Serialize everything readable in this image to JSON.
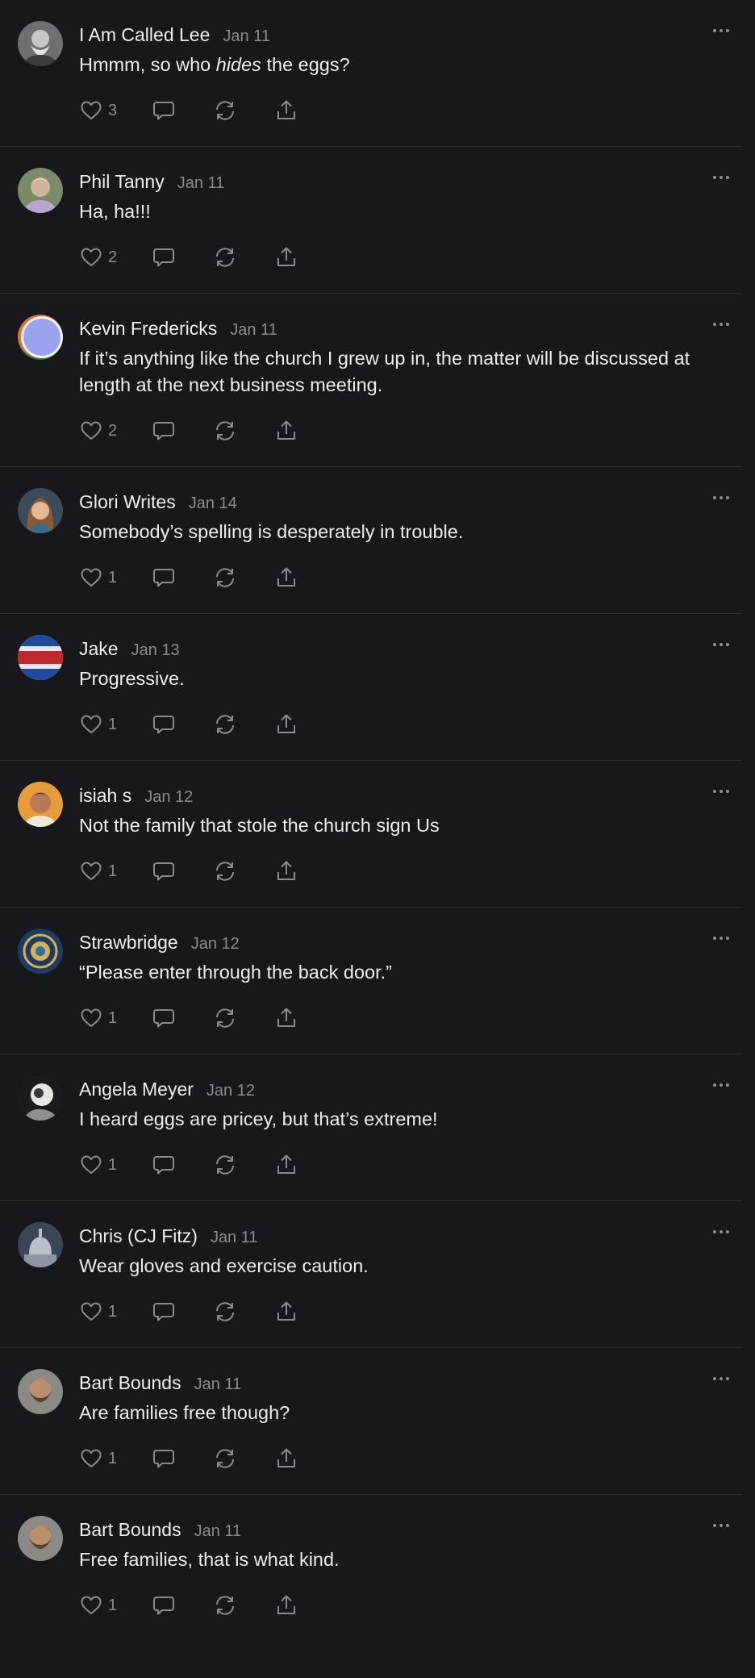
{
  "comments": [
    {
      "author": "I Am Called Lee",
      "date": "Jan 11",
      "text_before": "Hmmm, so who ",
      "text_em": "hides",
      "text_after": " the eggs?",
      "likes": "3",
      "avatar": {
        "icon": "avatar-bearded-man",
        "bg": "#6e6f72",
        "fg": "#d8d8d8"
      }
    },
    {
      "author": "Phil Tanny",
      "date": "Jan 11",
      "text": "Ha, ha!!!",
      "likes": "2",
      "avatar": {
        "icon": "avatar-man-outdoors",
        "bg": "#7d8a6a",
        "fg": "#c9b7d6"
      }
    },
    {
      "author": "Kevin Fredericks",
      "date": "Jan 11",
      "text": "If it’s anything like the church I grew up in, the matter will be discussed at length at the next business meeting.",
      "likes": "2",
      "avatar": {
        "icon": "avatar-color-rings",
        "bg": "#e3722f",
        "fg": "#9aa3ec"
      }
    },
    {
      "author": "Glori Writes",
      "date": "Jan 14",
      "text": "Somebody’s spelling is desperately in trouble.",
      "likes": "1",
      "avatar": {
        "icon": "avatar-woman",
        "bg": "#3c4b5a",
        "fg": "#c78c62"
      }
    },
    {
      "author": "Jake",
      "date": "Jan 13",
      "text": "Progressive.",
      "likes": "1",
      "avatar": {
        "icon": "avatar-costco-sign",
        "bg": "#e8e6e9",
        "fg": "#c0282c"
      }
    },
    {
      "author": "isiah s",
      "date": "Jan 12",
      "text": "Not the family that stole the church sign Us",
      "likes": "1",
      "avatar": {
        "icon": "avatar-man-orange",
        "bg": "#e59d3a",
        "fg": "#7b4a2d"
      }
    },
    {
      "author": "Strawbridge",
      "date": "Jan 12",
      "text": "“Please enter through the back door.”",
      "likes": "1",
      "avatar": {
        "icon": "avatar-mandala",
        "bg": "#1e3b66",
        "fg": "#d8b34b"
      }
    },
    {
      "author": "Angela Meyer",
      "date": "Jan 12",
      "text": "I heard eggs are pricey, but that’s extreme!",
      "likes": "1",
      "avatar": {
        "icon": "avatar-bw-portrait",
        "bg": "#1b1b1b",
        "fg": "#e6e6e6"
      }
    },
    {
      "author": "Chris (CJ Fitz)",
      "date": "Jan 11",
      "text": "Wear gloves and exercise caution.",
      "likes": "1",
      "avatar": {
        "icon": "avatar-capitol",
        "bg": "#3a4656",
        "fg": "#b9c0c9"
      }
    },
    {
      "author": "Bart Bounds",
      "date": "Jan 11",
      "text": "Are families free though?",
      "likes": "1",
      "avatar": {
        "icon": "avatar-bearded-caveman",
        "bg": "#8c8a86",
        "fg": "#5a4334"
      }
    },
    {
      "author": "Bart Bounds",
      "date": "Jan 11",
      "text": "Free families, that is what kind.",
      "likes": "1",
      "avatar": {
        "icon": "avatar-bearded-caveman",
        "bg": "#8c8a86",
        "fg": "#5a4334"
      }
    }
  ],
  "icons": {
    "like": "heart-icon",
    "reply": "speech-bubble-icon",
    "restack": "restack-icon",
    "share": "share-icon",
    "more": "more-dots-icon"
  },
  "colors": {
    "background": "#17181b",
    "divider": "#2b2c30",
    "muted": "#8a8b90",
    "text": "#ececed"
  }
}
